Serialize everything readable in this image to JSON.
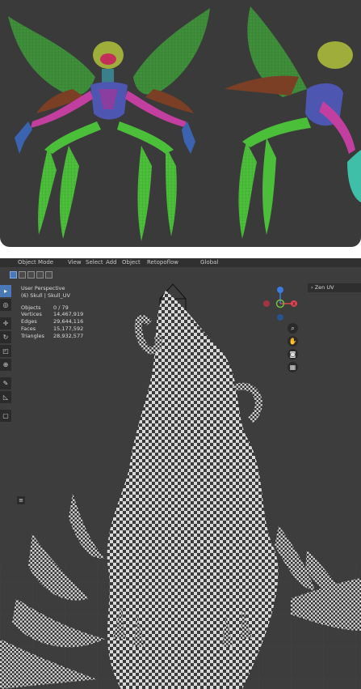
{
  "render_panel": {
    "alt": ""
  },
  "header": {
    "items": [
      "Object Mode",
      "View",
      "Select",
      "Add",
      "Object",
      "Retopoflow",
      "Global",
      "",
      ""
    ]
  },
  "viewport": {
    "view_name": "User Perspective",
    "active_object": "(6) Skull | Skull_UV",
    "stats": [
      {
        "label": "Objects",
        "value": "0 / 79"
      },
      {
        "label": "Vertices",
        "value": "14,467,919"
      },
      {
        "label": "Edges",
        "value": "29,644,116"
      },
      {
        "label": "Faces",
        "value": "15,177,592"
      },
      {
        "label": "Triangles",
        "value": "28,932,577"
      }
    ],
    "sidebar_panel": "Zen UV",
    "gizmo": {
      "x_label": "X",
      "y_label": "",
      "z_label": ""
    }
  },
  "colors": {
    "viewport_bg": "#3d3d3d",
    "render_bg": "#3a3a3a",
    "accent": "#4a79b8",
    "axis_x": "#e0454f",
    "axis_y": "#6fbe3b",
    "axis_z": "#3c7be0"
  },
  "icons": {
    "tools": [
      "select-icon",
      "cursor-icon",
      "move-icon",
      "rotate-icon",
      "scale-icon",
      "transform-icon",
      "annotate-icon",
      "measure-icon",
      "add-cube-icon"
    ],
    "nav": [
      "zoom-icon",
      "pan-hand-icon",
      "camera-icon",
      "grid-icon"
    ]
  }
}
